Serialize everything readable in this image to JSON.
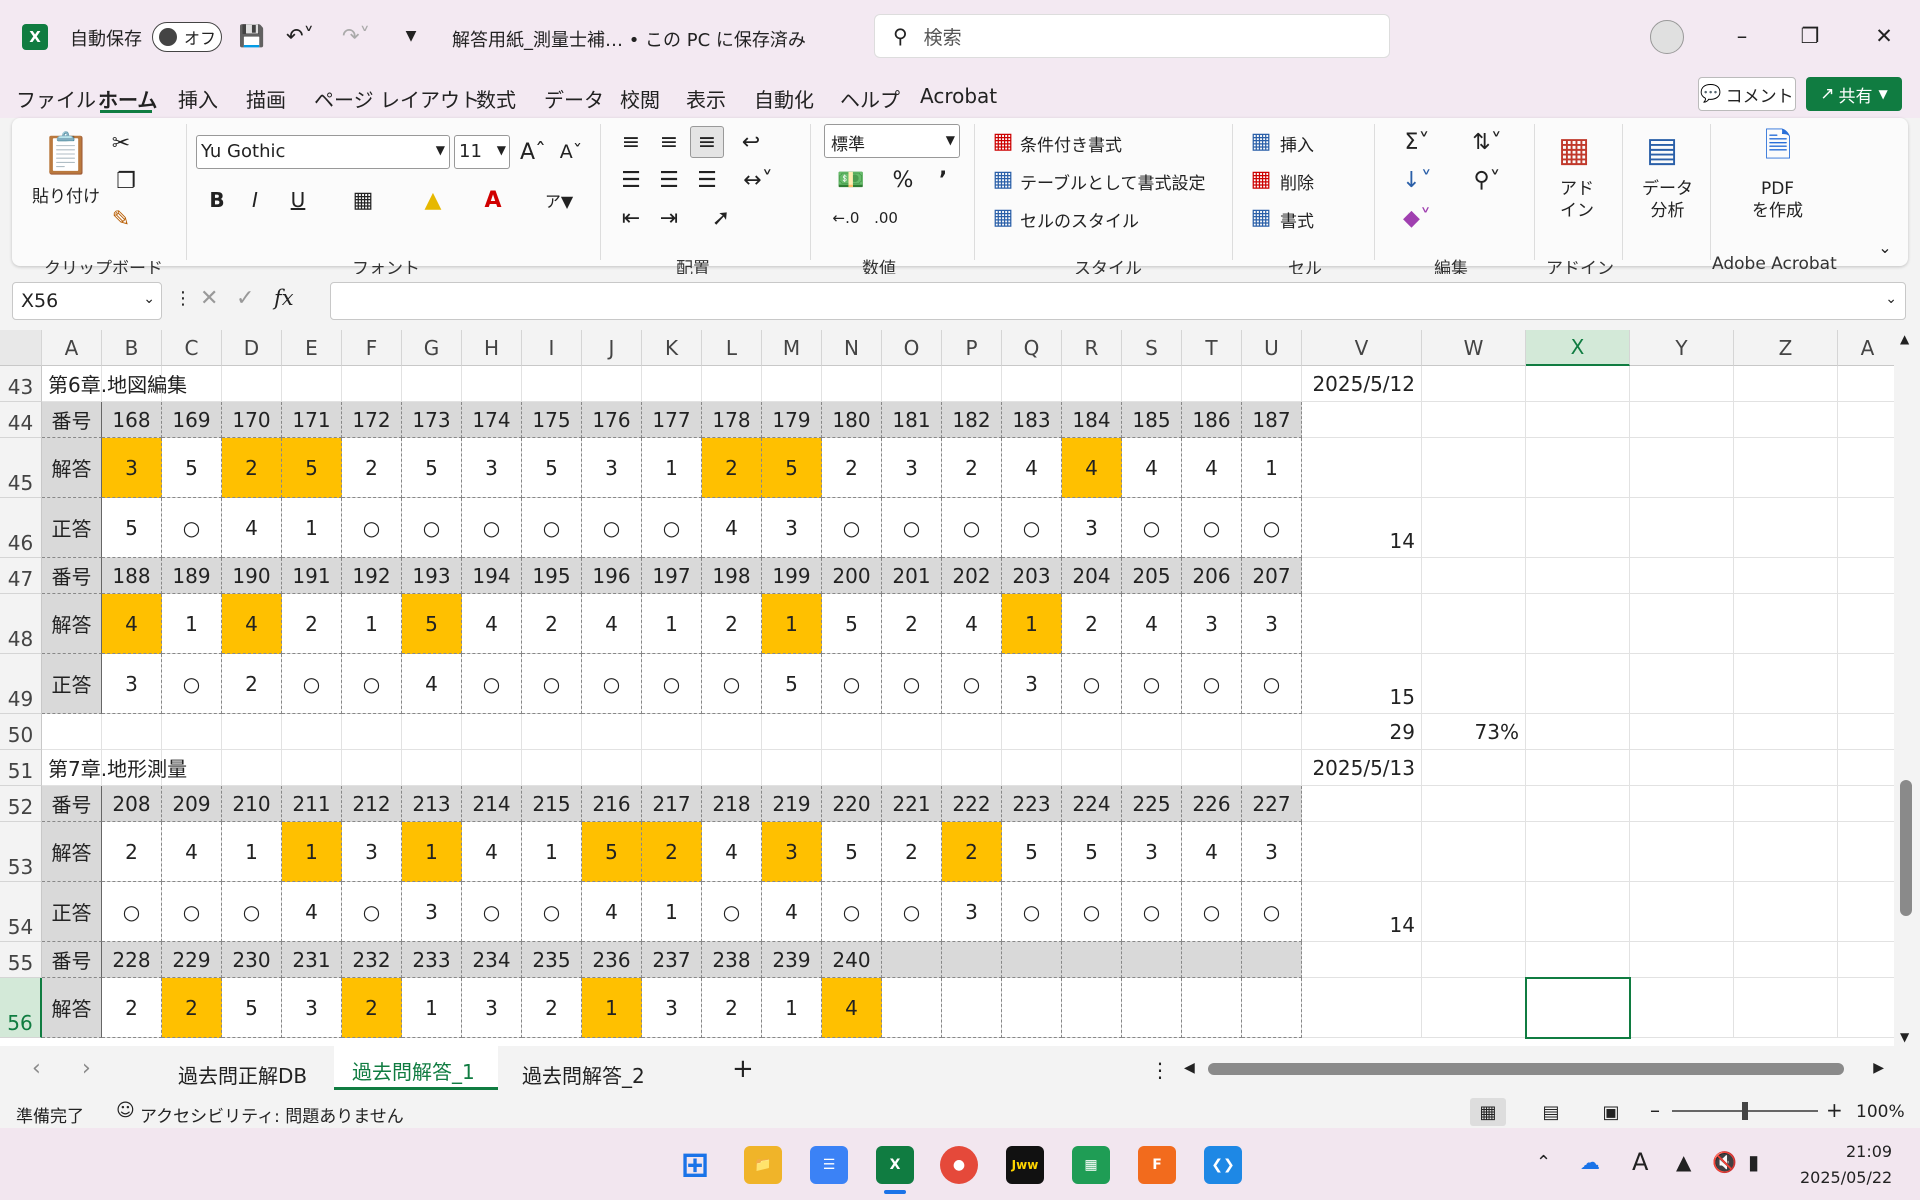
{
  "title": {
    "autosave_label": "自動保存",
    "autosave_state": "オフ",
    "doc_title": "解答用紙_測量士補… • この PC に保存済み",
    "search_placeholder": "検索"
  },
  "menu": [
    "ファイル",
    "ホーム",
    "挿入",
    "描画",
    "ページ レイアウト",
    "数式",
    "データ",
    "校閲",
    "表示",
    "自動化",
    "ヘルプ",
    "Acrobat"
  ],
  "comment_btn": "コメント",
  "share_btn": "共有",
  "ribbon": {
    "paste": "貼り付け",
    "font_name": "Yu Gothic",
    "font_size": "11",
    "number_format": "標準",
    "cond_format": "条件付き書式",
    "table_format": "テーブルとして書式設定",
    "cell_style": "セルのスタイル",
    "insert": "挿入",
    "delete": "削除",
    "format": "書式",
    "addin": "アド\nイン",
    "data_analysis": "データ\n分析",
    "pdf": "PDF\nを作成",
    "groups": [
      "クリップボード",
      "フォント",
      "配置",
      "数値",
      "スタイル",
      "セル",
      "編集",
      "アドイン",
      "Adobe Acrobat"
    ]
  },
  "formula_bar": {
    "name_box": "X56",
    "fx": "fx",
    "value": ""
  },
  "columns": [
    "A",
    "B",
    "C",
    "D",
    "E",
    "F",
    "G",
    "H",
    "I",
    "J",
    "K",
    "L",
    "M",
    "N",
    "O",
    "P",
    "Q",
    "R",
    "S",
    "T",
    "U",
    "V",
    "W",
    "X",
    "Y",
    "Z",
    "A"
  ],
  "rows": [
    "43",
    "44",
    "45",
    "46",
    "47",
    "48",
    "49",
    "50",
    "51",
    "52",
    "53",
    "54",
    "55",
    "56"
  ],
  "sheet": {
    "ch6": "第6章.地図編集",
    "ch6_date": "2025/5/12",
    "ch7": "第7章.地形測量",
    "ch7_date": "2025/5/13",
    "lbl_no": "番号",
    "lbl_ans": "解答",
    "lbl_cor": "正答",
    "r44": [
      "168",
      "169",
      "170",
      "171",
      "172",
      "173",
      "174",
      "175",
      "176",
      "177",
      "178",
      "179",
      "180",
      "181",
      "182",
      "183",
      "184",
      "185",
      "186",
      "187"
    ],
    "r45": [
      "3",
      "5",
      "2",
      "5",
      "2",
      "5",
      "3",
      "5",
      "3",
      "1",
      "2",
      "5",
      "2",
      "3",
      "2",
      "4",
      "4",
      "4",
      "4",
      "1"
    ],
    "r45_hl": [
      0,
      2,
      3,
      10,
      11,
      16
    ],
    "r46": [
      "5",
      "○",
      "4",
      "1",
      "○",
      "○",
      "○",
      "○",
      "○",
      "○",
      "4",
      "3",
      "○",
      "○",
      "○",
      "○",
      "3",
      "○",
      "○",
      "○"
    ],
    "r46_v": "14",
    "r47": [
      "188",
      "189",
      "190",
      "191",
      "192",
      "193",
      "194",
      "195",
      "196",
      "197",
      "198",
      "199",
      "200",
      "201",
      "202",
      "203",
      "204",
      "205",
      "206",
      "207"
    ],
    "r48": [
      "4",
      "1",
      "4",
      "2",
      "1",
      "5",
      "4",
      "2",
      "4",
      "1",
      "2",
      "1",
      "5",
      "2",
      "4",
      "1",
      "2",
      "4",
      "3",
      "3"
    ],
    "r48_hl": [
      0,
      2,
      5,
      11,
      15
    ],
    "r49": [
      "3",
      "○",
      "2",
      "○",
      "○",
      "4",
      "○",
      "○",
      "○",
      "○",
      "○",
      "5",
      "○",
      "○",
      "○",
      "3",
      "○",
      "○",
      "○",
      "○"
    ],
    "r49_v": "15",
    "r50_v": "29",
    "r50_w": "73%",
    "r52": [
      "208",
      "209",
      "210",
      "211",
      "212",
      "213",
      "214",
      "215",
      "216",
      "217",
      "218",
      "219",
      "220",
      "221",
      "222",
      "223",
      "224",
      "225",
      "226",
      "227"
    ],
    "r53": [
      "2",
      "4",
      "1",
      "1",
      "3",
      "1",
      "4",
      "1",
      "5",
      "2",
      "4",
      "3",
      "5",
      "2",
      "2",
      "5",
      "5",
      "3",
      "4",
      "3"
    ],
    "r53_hl": [
      3,
      5,
      8,
      9,
      11,
      14
    ],
    "r54": [
      "○",
      "○",
      "○",
      "4",
      "○",
      "3",
      "○",
      "○",
      "4",
      "1",
      "○",
      "4",
      "○",
      "○",
      "3",
      "○",
      "○",
      "○",
      "○",
      "○"
    ],
    "r54_v": "14",
    "r55": [
      "228",
      "229",
      "230",
      "231",
      "232",
      "233",
      "234",
      "235",
      "236",
      "237",
      "238",
      "239",
      "240",
      "",
      "",
      "",
      "",
      "",
      "",
      ""
    ],
    "r56": [
      "2",
      "2",
      "5",
      "3",
      "2",
      "1",
      "3",
      "2",
      "1",
      "3",
      "2",
      "1",
      "4",
      "",
      "",
      "",
      "",
      "",
      "",
      ""
    ],
    "r56_hl": [
      1,
      4,
      8,
      12
    ]
  },
  "sheet_tabs": [
    "過去問正解DB",
    "過去問解答_1",
    "過去問解答_2"
  ],
  "status": {
    "ready": "準備完了",
    "accessibility": "アクセシビリティ: 問題ありません",
    "zoom": "100%"
  },
  "taskbar": {
    "time": "21:09",
    "date": "2025/05/22"
  },
  "colors": {
    "highlight": "#ffc000",
    "label_gray": "#d9d9d9",
    "excel_green": "#107c41"
  }
}
